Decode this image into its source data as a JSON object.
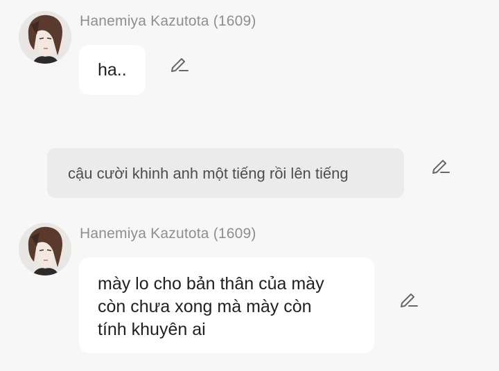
{
  "messages": [
    {
      "type": "character",
      "sender": "Hanemiya Kazutota (1609)",
      "text": "ha.."
    },
    {
      "type": "narration",
      "text": "cậu cười khinh anh một tiếng rồi lên tiếng"
    },
    {
      "type": "character",
      "sender": "Hanemiya Kazutota (1609)",
      "text": "mày lo cho bản thân của mày\ncòn chưa xong mà mày còn\ntính khuyên ai"
    }
  ],
  "icons": {
    "edit": "pencil-edit-icon",
    "avatar": "character-avatar"
  },
  "colors": {
    "background": "#f7f7f7",
    "bubble": "#ffffff",
    "narration_bubble": "#ebebeb",
    "sender_name": "#8e8e8e",
    "icon": "#666666"
  }
}
